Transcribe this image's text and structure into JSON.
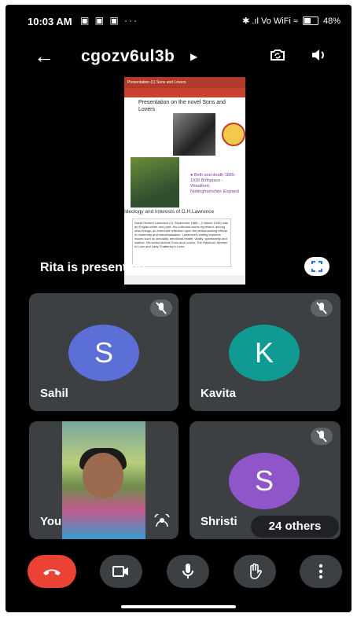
{
  "status_bar": {
    "time": "10:03 AM",
    "notifications": "▣ ▣ ▣  ···",
    "signals": "✱ .ıl Vo WiFi ≈",
    "battery": "48%"
  },
  "header": {
    "meeting_code": "cgozv6ul3b"
  },
  "presentation": {
    "presenter_text": "Rita is presenting",
    "slide": {
      "app_bar": "Presentation (1) Sons and Lovers",
      "title": "Presentation on the novel Sons and Lovers",
      "book_caption": "● Birth and death 1885-1930 Birthplace - Woodford, Nottinghamshire England",
      "ideas_heading": "Ideology and Interests of D.H.Lawrence",
      "paragraph": "David Herbert Lawrence (11 September 1885 – 2 March 1930) was an English writer and poet. His collected works represent, among other things, an extended reflection upon the dehumanising effects of modernity and industrialisation. Lawrence's writing explores issues such as sexuality, emotional health, vitality, spontaneity and instinct. His works include Sons and Lovers, The Rainbow, Women in Love and Lady Chatterley's Lover."
    }
  },
  "participants": [
    {
      "name": "Sahil",
      "initial": "S",
      "color": "#5b6fd6"
    },
    {
      "name": "Kavita",
      "initial": "K",
      "color": "#0f9a94"
    },
    {
      "name": "You",
      "initial": "",
      "color": ""
    },
    {
      "name": "Shristi",
      "initial": "S",
      "color": "#8e56c8"
    }
  ],
  "others_badge": "24 others",
  "colors": {
    "hangup": "#ea4335",
    "control_bg": "#3c4043"
  }
}
